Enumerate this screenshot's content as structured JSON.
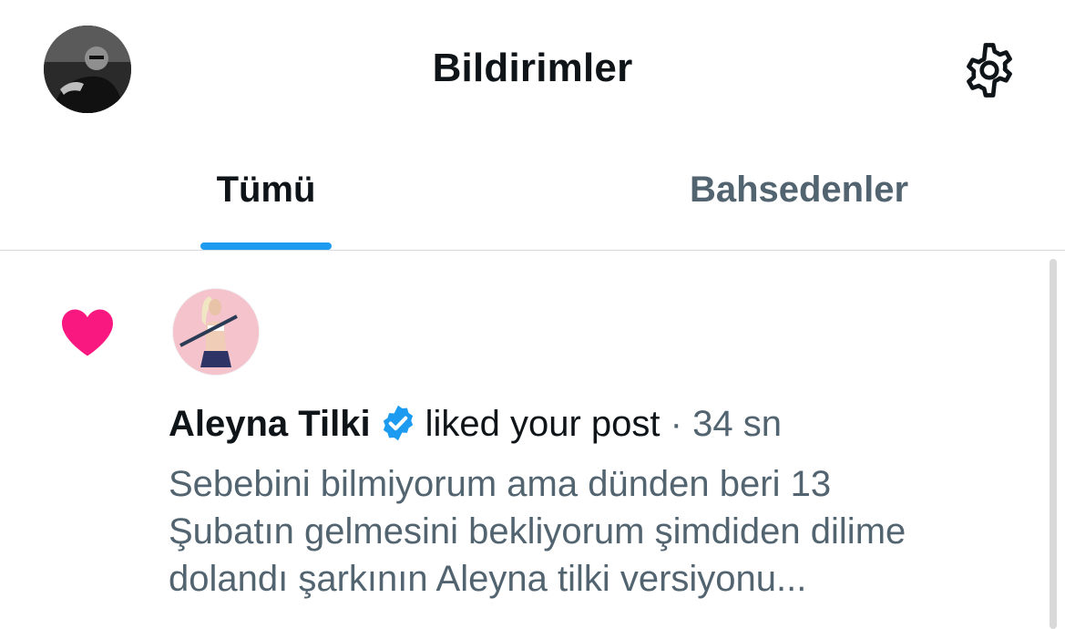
{
  "header": {
    "title": "Bildirimler",
    "avatar_icon": "profile-avatar",
    "settings_icon": "gear-icon"
  },
  "tabs": [
    {
      "label": "Tümü",
      "active": true
    },
    {
      "label": "Bahsedenler",
      "active": false
    }
  ],
  "notification": {
    "type_icon": "heart-icon",
    "user_name": "Aleyna Tilki",
    "verified": true,
    "action": "liked your post",
    "separator": "·",
    "time_ago": "34 sn",
    "post_lines": [
      "Sebebini bilmiyorum ama dünden beri 13",
      "Şubatın gelmesini bekliyorum şimdiden dilime",
      "dolandı şarkının Aleyna tilki versiyonu..."
    ]
  },
  "colors": {
    "accent": "#1d9bf0",
    "like": "#f91880",
    "primary_text": "#0f1419",
    "secondary_text": "#536471",
    "divider": "#d6dadd"
  }
}
